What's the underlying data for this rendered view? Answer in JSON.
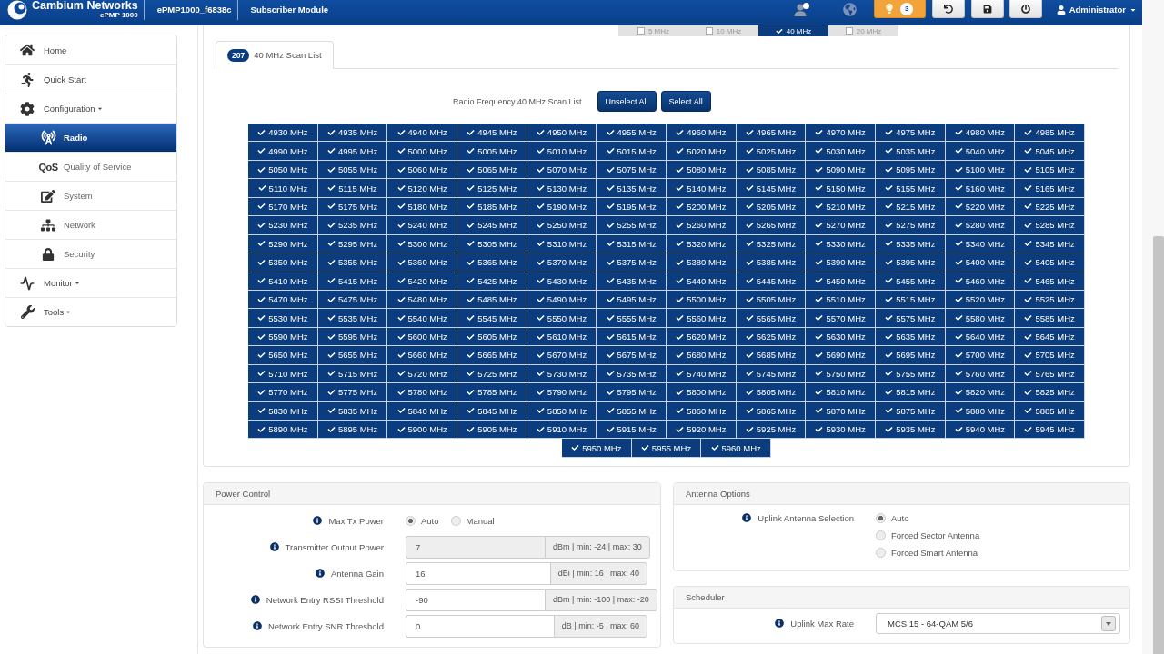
{
  "header": {
    "brand": "Cambium Networks",
    "model": "ePMP 1000",
    "device_name": "ePMP1000_f6838c",
    "mode": "Subscriber Module",
    "alert_count": "3",
    "user": "Administrator"
  },
  "sidebar": {
    "items": [
      {
        "label": "Home",
        "dropdown": false,
        "selected": false
      },
      {
        "label": "Quick Start",
        "dropdown": false,
        "selected": false
      },
      {
        "label": "Configuration",
        "dropdown": true,
        "selected": false,
        "children": [
          {
            "label": "Radio",
            "dropdown": false,
            "selected": true
          },
          {
            "label": "Quality of Service",
            "dropdown": false,
            "selected": false,
            "icon_text": "QoS"
          },
          {
            "label": "System",
            "dropdown": false,
            "selected": false
          },
          {
            "label": "Network",
            "dropdown": false,
            "selected": false
          },
          {
            "label": "Security",
            "dropdown": false,
            "selected": false
          }
        ]
      },
      {
        "label": "Monitor",
        "dropdown": true,
        "selected": false
      },
      {
        "label": "Tools",
        "dropdown": true,
        "selected": false
      }
    ]
  },
  "bandwidths": [
    {
      "label": "5 MHz",
      "checked": false
    },
    {
      "label": "10 MHz",
      "checked": false
    },
    {
      "label": "40 MHz",
      "checked": true
    },
    {
      "label": "20 MHz",
      "checked": false
    }
  ],
  "tabs": [
    {
      "count": "207",
      "label": "40 MHz Scan List",
      "selected": true
    }
  ],
  "scan_list": {
    "label": "Radio Frequency 40 MHz Scan List",
    "buttons": [
      "Unselect All",
      "Select All"
    ],
    "channels": [
      {
        "label": "4930 MHz",
        "checked": true
      },
      {
        "label": "4935 MHz",
        "checked": true
      },
      {
        "label": "4940 MHz",
        "checked": true
      },
      {
        "label": "4945 MHz",
        "checked": true
      },
      {
        "label": "4950 MHz",
        "checked": true
      },
      {
        "label": "4955 MHz",
        "checked": true
      },
      {
        "label": "4960 MHz",
        "checked": true
      },
      {
        "label": "4965 MHz",
        "checked": true
      },
      {
        "label": "4970 MHz",
        "checked": true
      },
      {
        "label": "4975 MHz",
        "checked": true
      },
      {
        "label": "4980 MHz",
        "checked": true
      },
      {
        "label": "4985 MHz",
        "checked": true
      },
      {
        "label": "4990 MHz",
        "checked": true
      },
      {
        "label": "4995 MHz",
        "checked": true
      },
      {
        "label": "5000 MHz",
        "checked": true
      },
      {
        "label": "5005 MHz",
        "checked": true
      },
      {
        "label": "5010 MHz",
        "checked": true
      },
      {
        "label": "5015 MHz",
        "checked": true
      },
      {
        "label": "5020 MHz",
        "checked": true
      },
      {
        "label": "5025 MHz",
        "checked": true
      },
      {
        "label": "5030 MHz",
        "checked": true
      },
      {
        "label": "5035 MHz",
        "checked": true
      },
      {
        "label": "5040 MHz",
        "checked": true
      },
      {
        "label": "5045 MHz",
        "checked": true
      },
      {
        "label": "5050 MHz",
        "checked": true
      },
      {
        "label": "5055 MHz",
        "checked": true
      },
      {
        "label": "5060 MHz",
        "checked": true
      },
      {
        "label": "5065 MHz",
        "checked": true
      },
      {
        "label": "5070 MHz",
        "checked": true
      },
      {
        "label": "5075 MHz",
        "checked": true
      },
      {
        "label": "5080 MHz",
        "checked": true
      },
      {
        "label": "5085 MHz",
        "checked": true
      },
      {
        "label": "5090 MHz",
        "checked": true
      },
      {
        "label": "5095 MHz",
        "checked": true
      },
      {
        "label": "5100 MHz",
        "checked": true
      },
      {
        "label": "5105 MHz",
        "checked": true
      },
      {
        "label": "5110 MHz",
        "checked": true
      },
      {
        "label": "5115 MHz",
        "checked": true
      },
      {
        "label": "5120 MHz",
        "checked": true
      },
      {
        "label": "5125 MHz",
        "checked": true
      },
      {
        "label": "5130 MHz",
        "checked": true
      },
      {
        "label": "5135 MHz",
        "checked": true
      },
      {
        "label": "5140 MHz",
        "checked": true
      },
      {
        "label": "5145 MHz",
        "checked": true
      },
      {
        "label": "5150 MHz",
        "checked": true
      },
      {
        "label": "5155 MHz",
        "checked": true
      },
      {
        "label": "5160 MHz",
        "checked": true
      },
      {
        "label": "5165 MHz",
        "checked": true
      },
      {
        "label": "5170 MHz",
        "checked": true
      },
      {
        "label": "5175 MHz",
        "checked": true
      },
      {
        "label": "5180 MHz",
        "checked": true
      },
      {
        "label": "5185 MHz",
        "checked": true
      },
      {
        "label": "5190 MHz",
        "checked": true
      },
      {
        "label": "5195 MHz",
        "checked": true
      },
      {
        "label": "5200 MHz",
        "checked": true
      },
      {
        "label": "5205 MHz",
        "checked": true
      },
      {
        "label": "5210 MHz",
        "checked": true
      },
      {
        "label": "5215 MHz",
        "checked": true
      },
      {
        "label": "5220 MHz",
        "checked": true
      },
      {
        "label": "5225 MHz",
        "checked": true
      },
      {
        "label": "5230 MHz",
        "checked": true
      },
      {
        "label": "5235 MHz",
        "checked": true
      },
      {
        "label": "5240 MHz",
        "checked": true
      },
      {
        "label": "5245 MHz",
        "checked": true
      },
      {
        "label": "5250 MHz",
        "checked": true
      },
      {
        "label": "5255 MHz",
        "checked": true
      },
      {
        "label": "5260 MHz",
        "checked": true
      },
      {
        "label": "5265 MHz",
        "checked": true
      },
      {
        "label": "5270 MHz",
        "checked": true
      },
      {
        "label": "5275 MHz",
        "checked": true
      },
      {
        "label": "5280 MHz",
        "checked": true
      },
      {
        "label": "5285 MHz",
        "checked": true
      },
      {
        "label": "5290 MHz",
        "checked": true
      },
      {
        "label": "5295 MHz",
        "checked": true
      },
      {
        "label": "5300 MHz",
        "checked": true
      },
      {
        "label": "5305 MHz",
        "checked": true
      },
      {
        "label": "5310 MHz",
        "checked": true
      },
      {
        "label": "5315 MHz",
        "checked": true
      },
      {
        "label": "5320 MHz",
        "checked": true
      },
      {
        "label": "5325 MHz",
        "checked": true
      },
      {
        "label": "5330 MHz",
        "checked": true
      },
      {
        "label": "5335 MHz",
        "checked": true
      },
      {
        "label": "5340 MHz",
        "checked": true
      },
      {
        "label": "5345 MHz",
        "checked": true
      },
      {
        "label": "5350 MHz",
        "checked": true
      },
      {
        "label": "5355 MHz",
        "checked": true
      },
      {
        "label": "5360 MHz",
        "checked": true
      },
      {
        "label": "5365 MHz",
        "checked": true
      },
      {
        "label": "5370 MHz",
        "checked": true
      },
      {
        "label": "5375 MHz",
        "checked": true
      },
      {
        "label": "5380 MHz",
        "checked": true
      },
      {
        "label": "5385 MHz",
        "checked": true
      },
      {
        "label": "5390 MHz",
        "checked": true
      },
      {
        "label": "5395 MHz",
        "checked": true
      },
      {
        "label": "5400 MHz",
        "checked": true
      },
      {
        "label": "5405 MHz",
        "checked": true
      },
      {
        "label": "5410 MHz",
        "checked": true
      },
      {
        "label": "5415 MHz",
        "checked": true
      },
      {
        "label": "5420 MHz",
        "checked": true
      },
      {
        "label": "5425 MHz",
        "checked": true
      },
      {
        "label": "5430 MHz",
        "checked": true
      },
      {
        "label": "5435 MHz",
        "checked": true
      },
      {
        "label": "5440 MHz",
        "checked": true
      },
      {
        "label": "5445 MHz",
        "checked": true
      },
      {
        "label": "5450 MHz",
        "checked": true
      },
      {
        "label": "5455 MHz",
        "checked": true
      },
      {
        "label": "5460 MHz",
        "checked": true
      },
      {
        "label": "5465 MHz",
        "checked": true
      },
      {
        "label": "5470 MHz",
        "checked": true
      },
      {
        "label": "5475 MHz",
        "checked": true
      },
      {
        "label": "5480 MHz",
        "checked": true
      },
      {
        "label": "5485 MHz",
        "checked": true
      },
      {
        "label": "5490 MHz",
        "checked": true
      },
      {
        "label": "5495 MHz",
        "checked": true
      },
      {
        "label": "5500 MHz",
        "checked": true
      },
      {
        "label": "5505 MHz",
        "checked": true
      },
      {
        "label": "5510 MHz",
        "checked": true
      },
      {
        "label": "5515 MHz",
        "checked": true
      },
      {
        "label": "5520 MHz",
        "checked": true
      },
      {
        "label": "5525 MHz",
        "checked": true
      },
      {
        "label": "5530 MHz",
        "checked": true
      },
      {
        "label": "5535 MHz",
        "checked": true
      },
      {
        "label": "5540 MHz",
        "checked": true
      },
      {
        "label": "5545 MHz",
        "checked": true
      },
      {
        "label": "5550 MHz",
        "checked": true
      },
      {
        "label": "5555 MHz",
        "checked": true
      },
      {
        "label": "5560 MHz",
        "checked": true
      },
      {
        "label": "5565 MHz",
        "checked": true
      },
      {
        "label": "5570 MHz",
        "checked": true
      },
      {
        "label": "5575 MHz",
        "checked": true
      },
      {
        "label": "5580 MHz",
        "checked": true
      },
      {
        "label": "5585 MHz",
        "checked": true
      },
      {
        "label": "5590 MHz",
        "checked": true
      },
      {
        "label": "5595 MHz",
        "checked": true
      },
      {
        "label": "5600 MHz",
        "checked": true
      },
      {
        "label": "5605 MHz",
        "checked": true
      },
      {
        "label": "5610 MHz",
        "checked": true
      },
      {
        "label": "5615 MHz",
        "checked": true
      },
      {
        "label": "5620 MHz",
        "checked": true
      },
      {
        "label": "5625 MHz",
        "checked": true
      },
      {
        "label": "5630 MHz",
        "checked": true
      },
      {
        "label": "5635 MHz",
        "checked": true
      },
      {
        "label": "5640 MHz",
        "checked": true
      },
      {
        "label": "5645 MHz",
        "checked": true
      },
      {
        "label": "5650 MHz",
        "checked": true
      },
      {
        "label": "5655 MHz",
        "checked": true
      },
      {
        "label": "5660 MHz",
        "checked": true
      },
      {
        "label": "5665 MHz",
        "checked": true
      },
      {
        "label": "5670 MHz",
        "checked": true
      },
      {
        "label": "5675 MHz",
        "checked": true
      },
      {
        "label": "5680 MHz",
        "checked": true
      },
      {
        "label": "5685 MHz",
        "checked": true
      },
      {
        "label": "5690 MHz",
        "checked": true
      },
      {
        "label": "5695 MHz",
        "checked": true
      },
      {
        "label": "5700 MHz",
        "checked": true
      },
      {
        "label": "5705 MHz",
        "checked": true
      },
      {
        "label": "5710 MHz",
        "checked": true
      },
      {
        "label": "5715 MHz",
        "checked": true
      },
      {
        "label": "5720 MHz",
        "checked": true
      },
      {
        "label": "5725 MHz",
        "checked": true
      },
      {
        "label": "5730 MHz",
        "checked": true
      },
      {
        "label": "5735 MHz",
        "checked": true
      },
      {
        "label": "5740 MHz",
        "checked": true
      },
      {
        "label": "5745 MHz",
        "checked": true
      },
      {
        "label": "5750 MHz",
        "checked": true
      },
      {
        "label": "5755 MHz",
        "checked": true
      },
      {
        "label": "5760 MHz",
        "checked": true
      },
      {
        "label": "5765 MHz",
        "checked": true
      },
      {
        "label": "5770 MHz",
        "checked": true
      },
      {
        "label": "5775 MHz",
        "checked": true
      },
      {
        "label": "5780 MHz",
        "checked": true
      },
      {
        "label": "5785 MHz",
        "checked": true
      },
      {
        "label": "5790 MHz",
        "checked": true
      },
      {
        "label": "5795 MHz",
        "checked": true
      },
      {
        "label": "5800 MHz",
        "checked": true
      },
      {
        "label": "5805 MHz",
        "checked": true
      },
      {
        "label": "5810 MHz",
        "checked": true
      },
      {
        "label": "5815 MHz",
        "checked": true
      },
      {
        "label": "5820 MHz",
        "checked": true
      },
      {
        "label": "5825 MHz",
        "checked": true
      },
      {
        "label": "5830 MHz",
        "checked": true
      },
      {
        "label": "5835 MHz",
        "checked": true
      },
      {
        "label": "5840 MHz",
        "checked": true
      },
      {
        "label": "5845 MHz",
        "checked": true
      },
      {
        "label": "5850 MHz",
        "checked": true
      },
      {
        "label": "5855 MHz",
        "checked": true
      },
      {
        "label": "5860 MHz",
        "checked": true
      },
      {
        "label": "5865 MHz",
        "checked": true
      },
      {
        "label": "5870 MHz",
        "checked": true
      },
      {
        "label": "5875 MHz",
        "checked": true
      },
      {
        "label": "5880 MHz",
        "checked": true
      },
      {
        "label": "5885 MHz",
        "checked": true
      },
      {
        "label": "5890 MHz",
        "checked": true
      },
      {
        "label": "5895 MHz",
        "checked": true
      },
      {
        "label": "5900 MHz",
        "checked": true
      },
      {
        "label": "5905 MHz",
        "checked": true
      },
      {
        "label": "5910 MHz",
        "checked": true
      },
      {
        "label": "5915 MHz",
        "checked": true
      },
      {
        "label": "5920 MHz",
        "checked": true
      },
      {
        "label": "5925 MHz",
        "checked": true
      },
      {
        "label": "5930 MHz",
        "checked": true
      },
      {
        "label": "5935 MHz",
        "checked": true
      },
      {
        "label": "5940 MHz",
        "checked": true
      },
      {
        "label": "5945 MHz",
        "checked": true
      },
      {
        "label": "5950 MHz",
        "checked": true
      },
      {
        "label": "5955 MHz",
        "checked": true
      },
      {
        "label": "5960 MHz",
        "checked": true
      }
    ]
  },
  "power_control": {
    "title": "Power Control",
    "fields": [
      {
        "kind": "radio",
        "label": "Max Tx Power",
        "options": [
          {
            "label": "Auto",
            "selected": true
          },
          {
            "label": "Manual",
            "selected": false
          }
        ]
      },
      {
        "kind": "input",
        "label": "Transmitter Output Power",
        "value": "7",
        "unit": "dBm | min: -24 | max: 30",
        "disabled": true
      },
      {
        "kind": "input",
        "label": "Antenna Gain",
        "value": "16",
        "unit": "dBi | min: 16 | max: 40",
        "disabled": false
      },
      {
        "kind": "input",
        "label": "Network Entry RSSI Threshold",
        "value": "-90",
        "unit": "dBm | min: -100 | max: -20",
        "disabled": false
      },
      {
        "kind": "input",
        "label": "Network Entry SNR Threshold",
        "value": "0",
        "unit": "dB | min: -5 | max: 60",
        "disabled": false
      }
    ]
  },
  "antenna_options": {
    "title": "Antenna Options",
    "fields": [
      {
        "kind": "radiogroup",
        "label": "Uplink Antenna Selection",
        "options": [
          {
            "label": "Auto",
            "selected": true
          },
          {
            "label": "Forced Sector Antenna",
            "selected": false
          },
          {
            "label": "Forced Smart Antenna",
            "selected": false
          }
        ]
      }
    ]
  },
  "scheduler": {
    "title": "Scheduler",
    "fields": [
      {
        "kind": "select",
        "label": "Uplink Max Rate",
        "value": "MCS 15 - 64-QAM 5/6"
      }
    ]
  }
}
